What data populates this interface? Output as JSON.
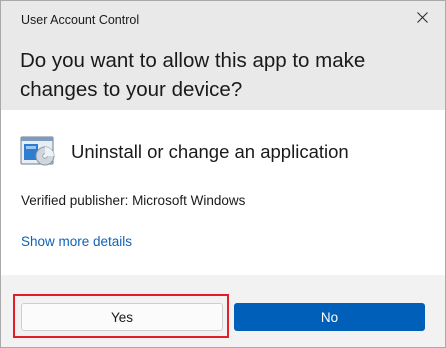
{
  "window": {
    "title": "User Account Control"
  },
  "header": {
    "question": "Do you want to allow this app to make changes to your device?"
  },
  "app": {
    "name": "Uninstall or change an application",
    "icon": "programs-and-features-icon",
    "publisher": "Verified publisher: Microsoft Windows"
  },
  "links": {
    "show_more": "Show more details"
  },
  "buttons": {
    "yes": "Yes",
    "no": "No"
  },
  "colors": {
    "header_bg": "#e9e9e9",
    "primary_button": "#005fb8",
    "link": "#0f62b8",
    "highlight": "#e01f26"
  }
}
